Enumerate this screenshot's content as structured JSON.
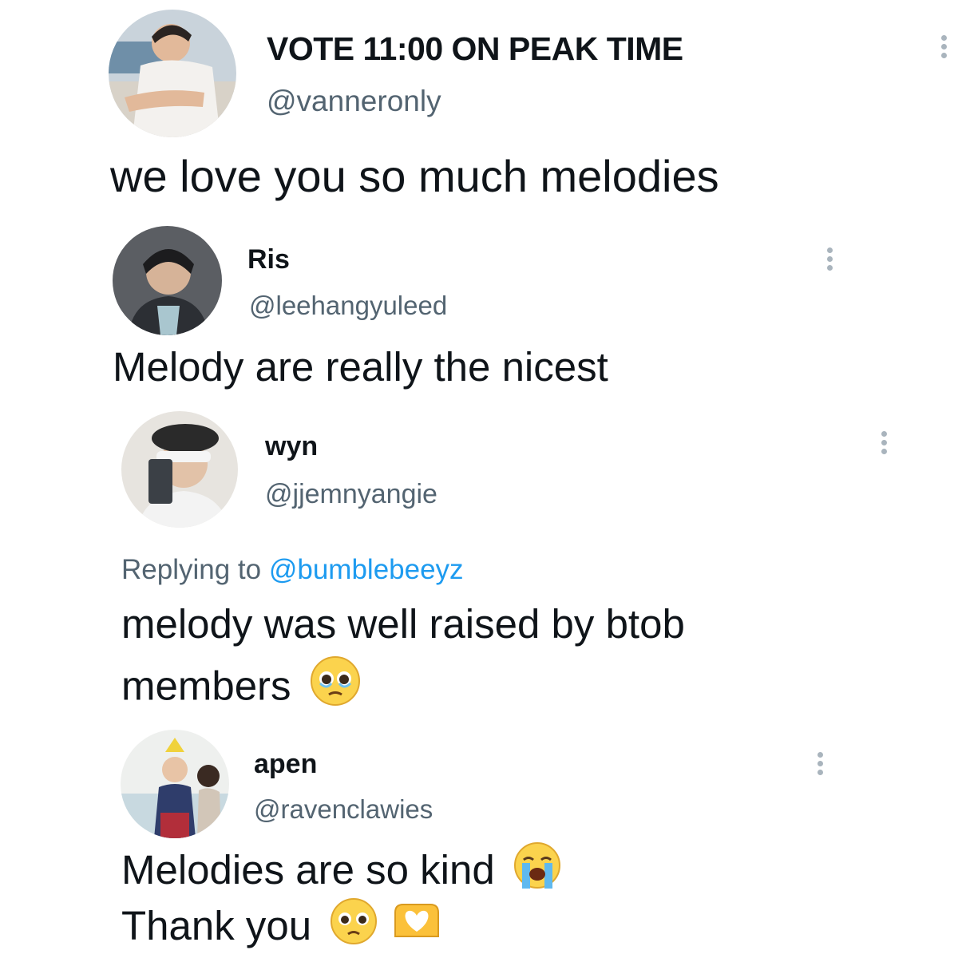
{
  "tweets": [
    {
      "display_name": "VOTE 11:00 ON PEAK TIME",
      "handle": "@vanneronly",
      "text": "we love you so much melodies"
    },
    {
      "display_name": "Ris",
      "handle": "@leehangyuleed",
      "text": "Melody are really the nicest"
    },
    {
      "display_name": "wyn",
      "handle": "@jjemnyangie",
      "reply_prefix": "Replying to",
      "reply_to": "@bumblebeeyz",
      "text_line1": "melody was well raised by btob",
      "text_line2": "members",
      "emoji": "pleading-face"
    },
    {
      "display_name": "apen",
      "handle": "@ravenclawies",
      "text_line1": "Melodies are so kind",
      "text_line2": "Thank you",
      "emoji_line1": "loudly-crying-face",
      "emoji_line2": [
        "pleading-face",
        "heart-hands"
      ]
    }
  ],
  "colors": {
    "text": "#0f1419",
    "secondary": "#536471",
    "link": "#1d9bf0",
    "more_dots": "#a9b4bd"
  }
}
